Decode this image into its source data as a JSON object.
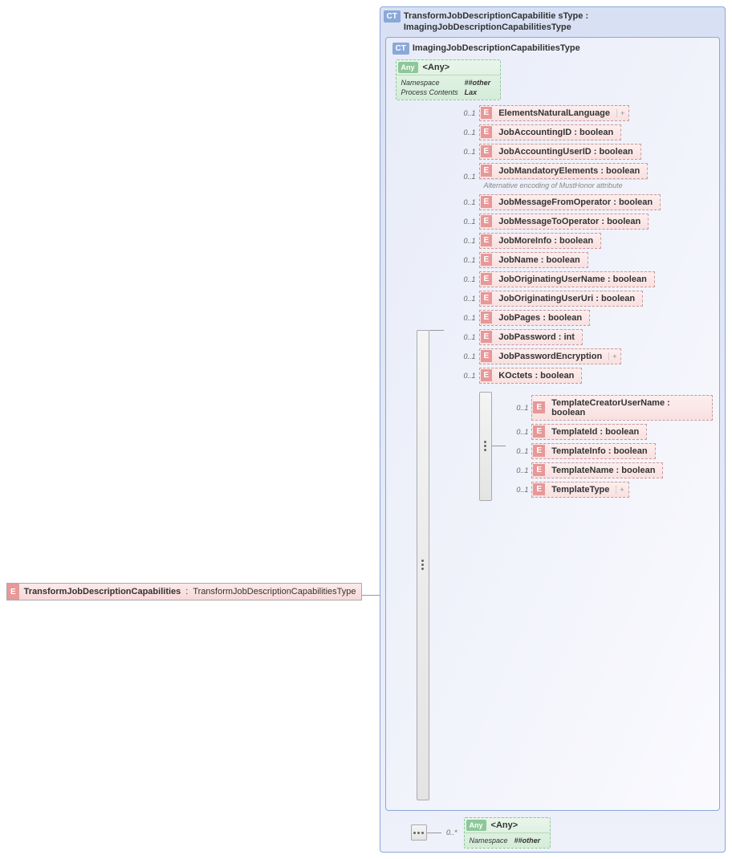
{
  "root": {
    "badge": "E",
    "name": "TransformJobDescriptionCapabilities",
    "type": "TransformJobDescriptionCapabilitiesType"
  },
  "outer": {
    "badge": "CT",
    "name": "TransformJobDescriptionCapabilitie sType :",
    "type": "ImagingJobDescriptionCapabilitiesType"
  },
  "inner": {
    "badge": "CT",
    "name": "ImagingJobDescriptionCapabilitiesType"
  },
  "anyTop": {
    "badge": "Any",
    "title": "<Any>",
    "nsLabel": "Namespace",
    "nsVal": "##other",
    "pcLabel": "Process Contents",
    "pcVal": "Lax"
  },
  "elements": [
    {
      "card": "0..1",
      "label": "ElementsNaturalLanguage",
      "expand": true
    },
    {
      "card": "0..1",
      "label": "JobAccountingID : boolean"
    },
    {
      "card": "0..1",
      "label": "JobAccountingUserID : boolean"
    },
    {
      "card": "0..1",
      "label": "JobMandatoryElements : boolean",
      "annot": "Alternative encoding of MustHonor attribute"
    },
    {
      "card": "0..1",
      "label": "JobMessageFromOperator : boolean"
    },
    {
      "card": "0..1",
      "label": "JobMessageToOperator : boolean"
    },
    {
      "card": "0..1",
      "label": "JobMoreInfo : boolean"
    },
    {
      "card": "0..1",
      "label": "JobName : boolean"
    },
    {
      "card": "0..1",
      "label": "JobOriginatingUserName : boolean"
    },
    {
      "card": "0..1",
      "label": "JobOriginatingUserUri : boolean"
    },
    {
      "card": "0..1",
      "label": "JobPages : boolean"
    },
    {
      "card": "0..1",
      "label": "JobPassword : int"
    },
    {
      "card": "0..1",
      "label": "JobPasswordEncryption",
      "expand": true
    },
    {
      "card": "0..1",
      "label": "KOctets  : boolean"
    }
  ],
  "templateElements": [
    {
      "card": "0..1",
      "label": "TemplateCreatorUserName : boolean"
    },
    {
      "card": "0..1",
      "label": "TemplateId : boolean"
    },
    {
      "card": "0..1",
      "label": "TemplateInfo : boolean"
    },
    {
      "card": "0..1",
      "label": "TemplateName : boolean"
    },
    {
      "card": "0..1",
      "label": "TemplateType",
      "expand": true
    }
  ],
  "anyBottom": {
    "card": "0..*",
    "badge": "Any",
    "title": "<Any>",
    "nsLabel": "Namespace",
    "nsVal": "##other"
  },
  "eBadge": "E",
  "expandSym": "+"
}
